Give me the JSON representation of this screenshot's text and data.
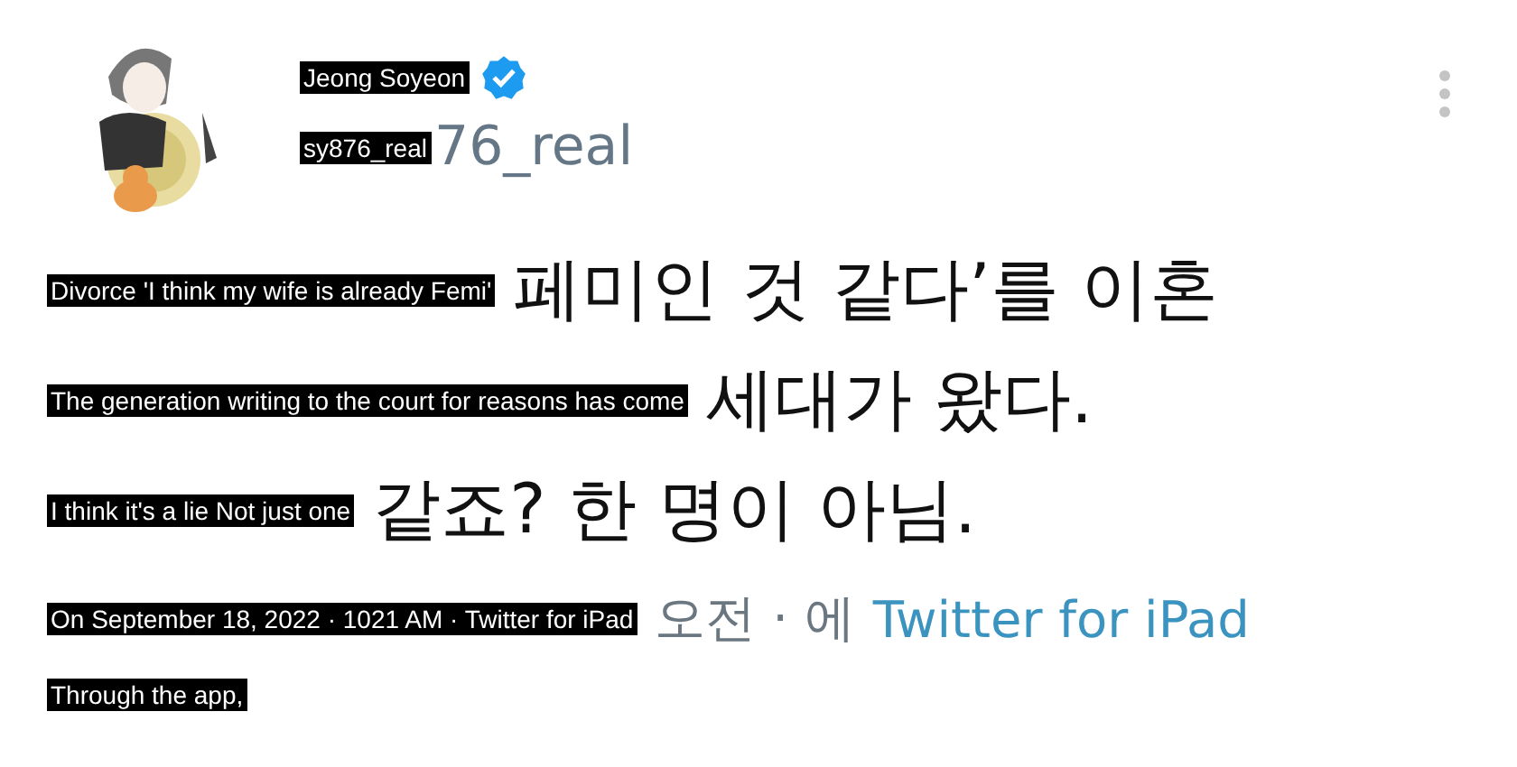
{
  "tweet": {
    "author": {
      "name": "Jeong Soyeon",
      "verified": true,
      "handle_overlay": "sy876_real",
      "handle": "76_real"
    },
    "lines": [
      {
        "overlay": "Divorce 'I think my wife is already Femi'",
        "text": "페미인 것 같다’를 이혼"
      },
      {
        "overlay": "The generation writing to the court for reasons has come",
        "text": "세대가 왔다."
      },
      {
        "overlay": "I think it's a lie Not just one",
        "text": "같죠? 한 명이 아님."
      }
    ],
    "meta": {
      "overlay": "On September 18, 2022 · 1021 AM · Twitter for iPad",
      "text": "오전 · 에",
      "source": "Twitter for iPad"
    },
    "meta_end": {
      "overlay": "Through the app,"
    }
  }
}
